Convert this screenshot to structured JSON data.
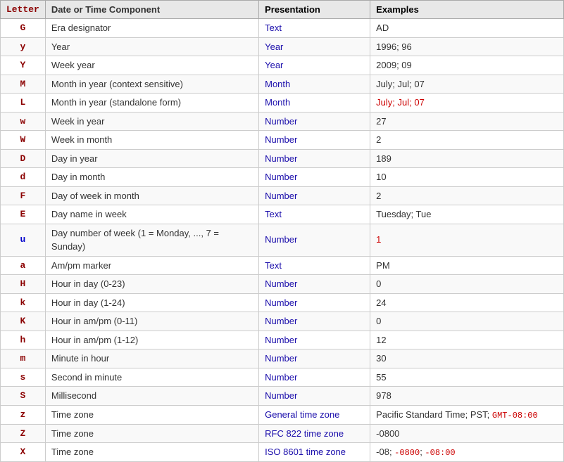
{
  "table": {
    "headers": [
      "Letter",
      "Date or Time Component",
      "Presentation",
      "Examples"
    ],
    "rows": [
      {
        "letter": "G",
        "letter_color": "red",
        "component": "Era designator",
        "presentation": "Text",
        "presentation_color": "blue",
        "examples": "AD",
        "examples_color": "normal"
      },
      {
        "letter": "y",
        "letter_color": "red",
        "component": "Year",
        "presentation": "Year",
        "presentation_color": "blue",
        "examples": "1996; 96",
        "examples_color": "normal"
      },
      {
        "letter": "Y",
        "letter_color": "red",
        "component": "Week year",
        "presentation": "Year",
        "presentation_color": "blue",
        "examples": "2009; 09",
        "examples_color": "normal"
      },
      {
        "letter": "M",
        "letter_color": "red",
        "component": "Month in year (context sensitive)",
        "presentation": "Month",
        "presentation_color": "blue",
        "examples": "July; Jul; 07",
        "examples_color": "normal"
      },
      {
        "letter": "L",
        "letter_color": "red",
        "component": "Month in year (standalone form)",
        "presentation": "Month",
        "presentation_color": "blue",
        "examples": "July; Jul; 07",
        "examples_color": "red"
      },
      {
        "letter": "w",
        "letter_color": "red",
        "component": "Week in year",
        "presentation": "Number",
        "presentation_color": "blue",
        "examples": "27",
        "examples_color": "normal"
      },
      {
        "letter": "W",
        "letter_color": "red",
        "component": "Week in month",
        "presentation": "Number",
        "presentation_color": "blue",
        "examples": "2",
        "examples_color": "normal"
      },
      {
        "letter": "D",
        "letter_color": "red",
        "component": "Day in year",
        "presentation": "Number",
        "presentation_color": "blue",
        "examples": "189",
        "examples_color": "normal"
      },
      {
        "letter": "d",
        "letter_color": "red",
        "component": "Day in month",
        "presentation": "Number",
        "presentation_color": "blue",
        "examples": "10",
        "examples_color": "normal"
      },
      {
        "letter": "F",
        "letter_color": "red",
        "component": "Day of week in month",
        "presentation": "Number",
        "presentation_color": "blue",
        "examples": "2",
        "examples_color": "normal"
      },
      {
        "letter": "E",
        "letter_color": "red",
        "component": "Day name in week",
        "presentation": "Text",
        "presentation_color": "blue",
        "examples": "Tuesday; Tue",
        "examples_color": "normal"
      },
      {
        "letter": "u",
        "letter_color": "blue",
        "component": "Day number of week (1 = Monday, ..., 7 = Sunday)",
        "presentation": "Number",
        "presentation_color": "blue",
        "examples": "1",
        "examples_color": "red"
      },
      {
        "letter": "a",
        "letter_color": "red",
        "component": "Am/pm marker",
        "presentation": "Text",
        "presentation_color": "blue",
        "examples": "PM",
        "examples_color": "normal"
      },
      {
        "letter": "H",
        "letter_color": "red",
        "component": "Hour in day (0-23)",
        "presentation": "Number",
        "presentation_color": "blue",
        "examples": "0",
        "examples_color": "normal"
      },
      {
        "letter": "k",
        "letter_color": "red",
        "component": "Hour in day (1-24)",
        "presentation": "Number",
        "presentation_color": "blue",
        "examples": "24",
        "examples_color": "normal"
      },
      {
        "letter": "K",
        "letter_color": "red",
        "component": "Hour in am/pm (0-11)",
        "presentation": "Number",
        "presentation_color": "blue",
        "examples": "0",
        "examples_color": "normal"
      },
      {
        "letter": "h",
        "letter_color": "red",
        "component": "Hour in am/pm (1-12)",
        "presentation": "Number",
        "presentation_color": "blue",
        "examples": "12",
        "examples_color": "normal"
      },
      {
        "letter": "m",
        "letter_color": "red",
        "component": "Minute in hour",
        "presentation": "Number",
        "presentation_color": "blue",
        "examples": "30",
        "examples_color": "normal"
      },
      {
        "letter": "s",
        "letter_color": "red",
        "component": "Second in minute",
        "presentation": "Number",
        "presentation_color": "blue",
        "examples": "55",
        "examples_color": "normal"
      },
      {
        "letter": "S",
        "letter_color": "red",
        "component": "Millisecond",
        "presentation": "Number",
        "presentation_color": "blue",
        "examples": "978",
        "examples_color": "normal"
      },
      {
        "letter": "z",
        "letter_color": "red",
        "component": "Time zone",
        "presentation": "General time zone",
        "presentation_color": "blue",
        "examples": "Pacific Standard Time; PST; GMT-08:00",
        "examples_color": "mixed_z"
      },
      {
        "letter": "Z",
        "letter_color": "red",
        "component": "Time zone",
        "presentation": "RFC 822 time zone",
        "presentation_color": "blue",
        "examples": "-0800",
        "examples_color": "normal"
      },
      {
        "letter": "X",
        "letter_color": "red",
        "component": "Time zone",
        "presentation": "ISO 8601 time zone",
        "presentation_color": "blue",
        "examples": "-08; -0800; -08:00",
        "examples_color": "mixed_x"
      }
    ]
  }
}
